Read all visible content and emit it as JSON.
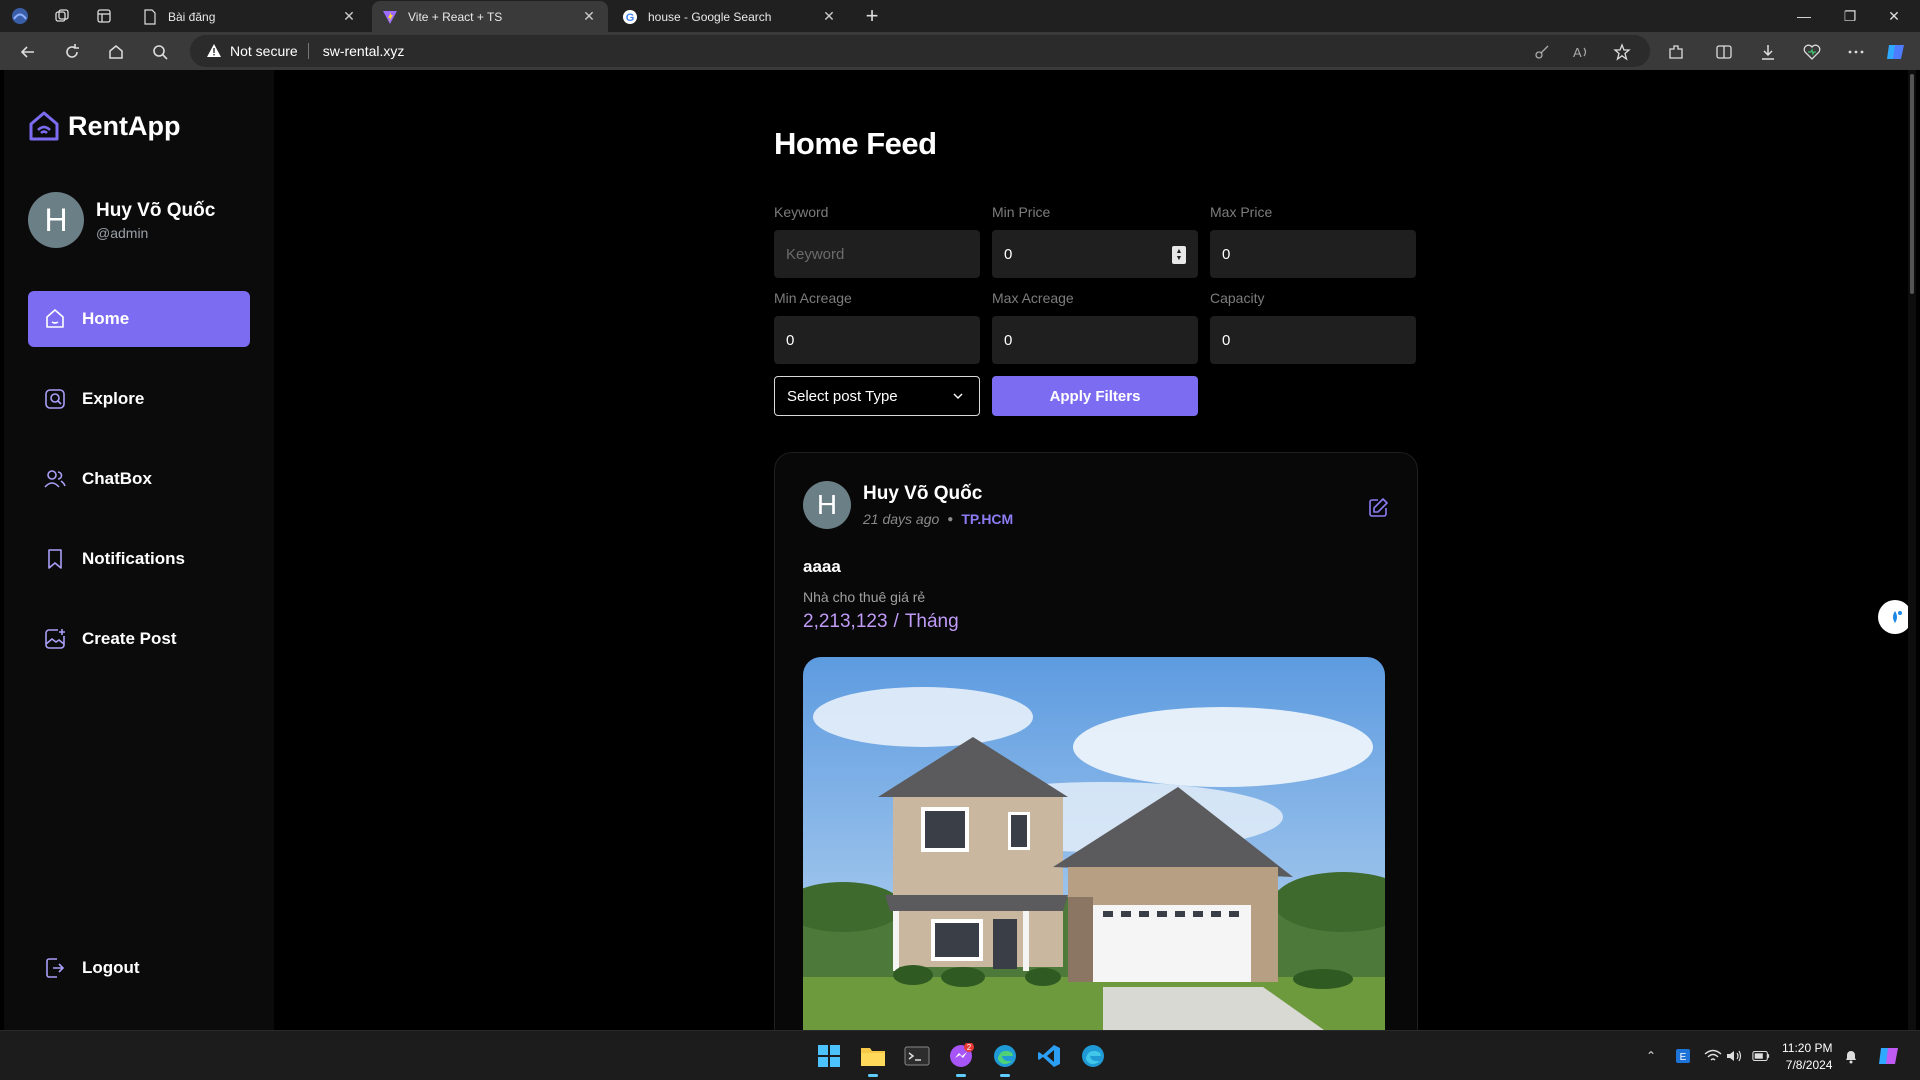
{
  "browser": {
    "tabs": [
      {
        "title": "Bài đăng",
        "icon": "page-icon",
        "active": false
      },
      {
        "title": "Vite + React + TS",
        "icon": "vite-icon",
        "active": true
      },
      {
        "title": "house - Google Search",
        "icon": "google-icon",
        "active": false
      }
    ],
    "security_label": "Not secure",
    "url": "sw-rental.xyz"
  },
  "sidebar": {
    "app_name": "RentApp",
    "user": {
      "initial": "H",
      "name": "Huy Võ Quốc",
      "handle": "@admin"
    },
    "nav": [
      {
        "label": "Home",
        "icon": "home-icon",
        "active": true
      },
      {
        "label": "Explore",
        "icon": "explore-icon",
        "active": false
      },
      {
        "label": "ChatBox",
        "icon": "users-icon",
        "active": false
      },
      {
        "label": "Notifications",
        "icon": "bookmark-icon",
        "active": false
      },
      {
        "label": "Create Post",
        "icon": "image-plus-icon",
        "active": false
      }
    ],
    "logout_label": "Logout"
  },
  "main": {
    "title": "Home Feed",
    "filters": {
      "keyword": {
        "label": "Keyword",
        "placeholder": "Keyword",
        "value": ""
      },
      "min_price": {
        "label": "Min Price",
        "value": "0"
      },
      "max_price": {
        "label": "Max Price",
        "value": "0"
      },
      "min_acreage": {
        "label": "Min Acreage",
        "value": "0"
      },
      "max_acreage": {
        "label": "Max Acreage",
        "value": "0"
      },
      "capacity": {
        "label": "Capacity",
        "value": "0"
      },
      "post_type": {
        "selected": "Select post Type"
      },
      "apply_label": "Apply Filters"
    },
    "post": {
      "author_initial": "H",
      "author": "Huy Võ Quốc",
      "time": "21 days ago",
      "location": "TP.HCM",
      "title": "aaaa",
      "description": "Nhà cho thuê giá rẻ",
      "price": "2,213,123",
      "price_unit": "Tháng",
      "image": "house-photo"
    }
  },
  "taskbar": {
    "time": "11:20 PM",
    "date": "7/8/2024",
    "messenger_badge": "2"
  },
  "colors": {
    "accent": "#7c6cf2",
    "price": "#c09af7",
    "location": "#8c7cf5"
  }
}
